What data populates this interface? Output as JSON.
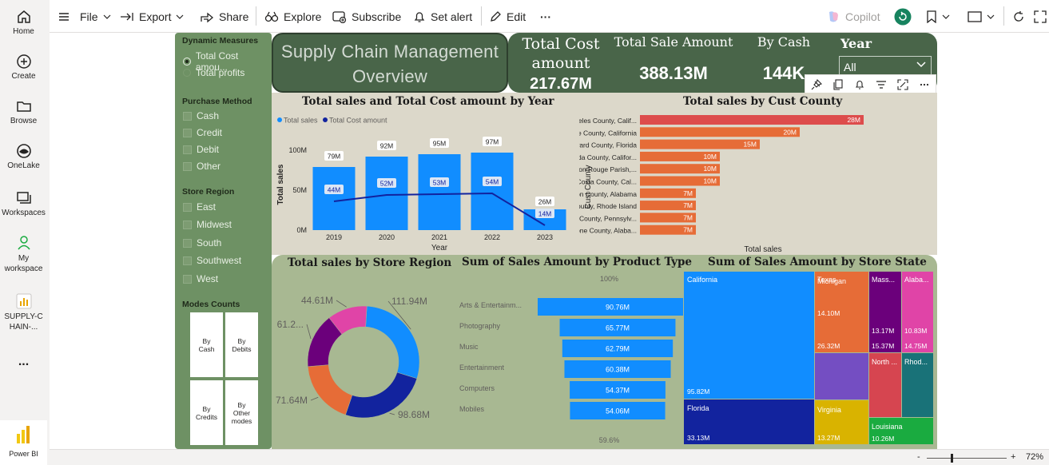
{
  "nav": {
    "items": [
      {
        "label": "Home",
        "icon": "home-icon"
      },
      {
        "label": "Create",
        "icon": "plus-circle-icon"
      },
      {
        "label": "Browse",
        "icon": "folder-icon"
      },
      {
        "label": "OneLake",
        "icon": "onelake-icon"
      },
      {
        "label": "Workspaces",
        "icon": "workspaces-icon"
      },
      {
        "label": "My workspace",
        "icon": "person-icon"
      },
      {
        "label": "SUPPLY-CHAIN-...",
        "icon": "report-icon"
      }
    ],
    "more": "...",
    "app_name": "Power BI"
  },
  "toolbar": {
    "file": "File",
    "export": "Export",
    "share": "Share",
    "explore": "Explore",
    "subscribe": "Subscribe",
    "set_alert": "Set alert",
    "edit": "Edit",
    "more": "···",
    "copilot": "Copilot"
  },
  "slicer": {
    "dynamic_title": "Dynamic Measures",
    "dynamic_options": [
      "Total Cost amou...",
      "Total profits"
    ],
    "purchase_title": "Purchase Method",
    "purchase_options": [
      "Cash",
      "Credit",
      "Debit",
      "Other"
    ],
    "region_title": "Store Region",
    "region_options": [
      "East",
      "Midwest",
      "South",
      "Southwest",
      "West"
    ],
    "modes_title": "Modes Counts",
    "modes": [
      "By Cash",
      "By Debits",
      "By Credits",
      "By Other modes"
    ]
  },
  "header": {
    "title": "Supply Chain Management Overview",
    "kpis": [
      {
        "label": "Total Cost amount",
        "value": "217.67M"
      },
      {
        "label": "Total Sale Amount",
        "value": "388.13M"
      },
      {
        "label": "By Cash",
        "value": "144K"
      }
    ],
    "year_label": "Year",
    "year_value": "All"
  },
  "status": {
    "zoom": "72%",
    "minus": "-",
    "plus": "+"
  },
  "chart_data": [
    {
      "type": "bar",
      "title": "Total sales and Total Cost amount by Year",
      "xlabel": "Year",
      "ylabel": "Total sales",
      "categories": [
        "2019",
        "2020",
        "2021",
        "2022",
        "2023"
      ],
      "series": [
        {
          "name": "Total sales",
          "values": [
            79,
            92,
            95,
            97,
            26
          ],
          "labels": [
            "79M",
            "92M",
            "95M",
            "97M",
            "26M"
          ],
          "color": "#118dff"
        },
        {
          "name": "Total Cost amount",
          "values": [
            44,
            52,
            53,
            54,
            14
          ],
          "labels": [
            "44M",
            "52M",
            "53M",
            "54M",
            "14M"
          ],
          "color": "#12239e"
        }
      ],
      "yticks": [
        "0M",
        "50M",
        "100M"
      ],
      "ylim": [
        0,
        110
      ]
    },
    {
      "type": "bar",
      "orientation": "horizontal",
      "title": "Total sales by Cust County",
      "xlabel": "Total sales",
      "ylabel": "Cust County",
      "categories": [
        "Los Angeles County, Calif...",
        "Orange County, California",
        "Broward County, Florida",
        "Alameda County, Califor...",
        "East Baton Rouge Parish,...",
        "Contra Costa County, Cal...",
        "Jefferson County, Alabama",
        "Kent County, Rhode Island",
        "Lehigh County, Pennsylv...",
        "Limestone County, Alaba..."
      ],
      "values": [
        28,
        20,
        15,
        10,
        10,
        10,
        7,
        7,
        7,
        7
      ],
      "labels": [
        "28M",
        "20M",
        "15M",
        "10M",
        "10M",
        "10M",
        "7M",
        "7M",
        "7M",
        "7M"
      ],
      "color": "#e66c37",
      "highlight_color": "#dd4c4c"
    },
    {
      "type": "pie",
      "donut": true,
      "title": "Total sales by Store Region",
      "values": [
        111.94,
        98.68,
        71.64,
        61.2,
        44.61
      ],
      "labels": [
        "111.94M",
        "98.68M",
        "71.64M",
        "61.2...",
        "44.61M"
      ],
      "colors": [
        "#118dff",
        "#12239e",
        "#e66c37",
        "#6b007b",
        "#e044a7"
      ]
    },
    {
      "type": "bar",
      "subtype": "funnel",
      "title": "Sum of Sales Amount by Product Type",
      "categories": [
        "Arts & Entertainm...",
        "Photography",
        "Music",
        "Entertainment",
        "Computers",
        "Mobiles"
      ],
      "values": [
        90.76,
        65.77,
        62.79,
        60.38,
        54.37,
        54.06
      ],
      "labels": [
        "90.76M",
        "65.77M",
        "62.79M",
        "60.38M",
        "54.37M",
        "54.06M"
      ],
      "top_pct": "100%",
      "bottom_pct": "59.6%",
      "color": "#118dff"
    },
    {
      "type": "heatmap",
      "subtype": "treemap",
      "title": "Sum of Sales Amount by Store State",
      "items": [
        {
          "name": "California",
          "value": 95.82,
          "label": "95.82M",
          "color": "#118dff"
        },
        {
          "name": "Florida",
          "value": 33.13,
          "label": "33.13M",
          "color": "#12239e"
        },
        {
          "name": "Texas",
          "value": 26.32,
          "label": "26.32M",
          "color": "#e66c37"
        },
        {
          "name": "Mass...",
          "value": 15.37,
          "label": "15.37M",
          "color": "#6b007b"
        },
        {
          "name": "Alaba...",
          "value": 14.75,
          "label": "14.75M",
          "color": "#e044a7"
        },
        {
          "name": "Michigan",
          "value": 14.1,
          "label": "14.10M",
          "color": "#744ec2"
        },
        {
          "name": "North ...",
          "value": 13.17,
          "label": "13.17M",
          "color": "#d64550"
        },
        {
          "name": "Rhod...",
          "value": 10.83,
          "label": "10.83M",
          "color": "#197278"
        },
        {
          "name": "Virginia",
          "value": 13.27,
          "label": "13.27M",
          "color": "#d9b300"
        },
        {
          "name": "Louisiana",
          "value": 10.26,
          "label": "10.26M",
          "color": "#1aab40"
        }
      ]
    }
  ]
}
